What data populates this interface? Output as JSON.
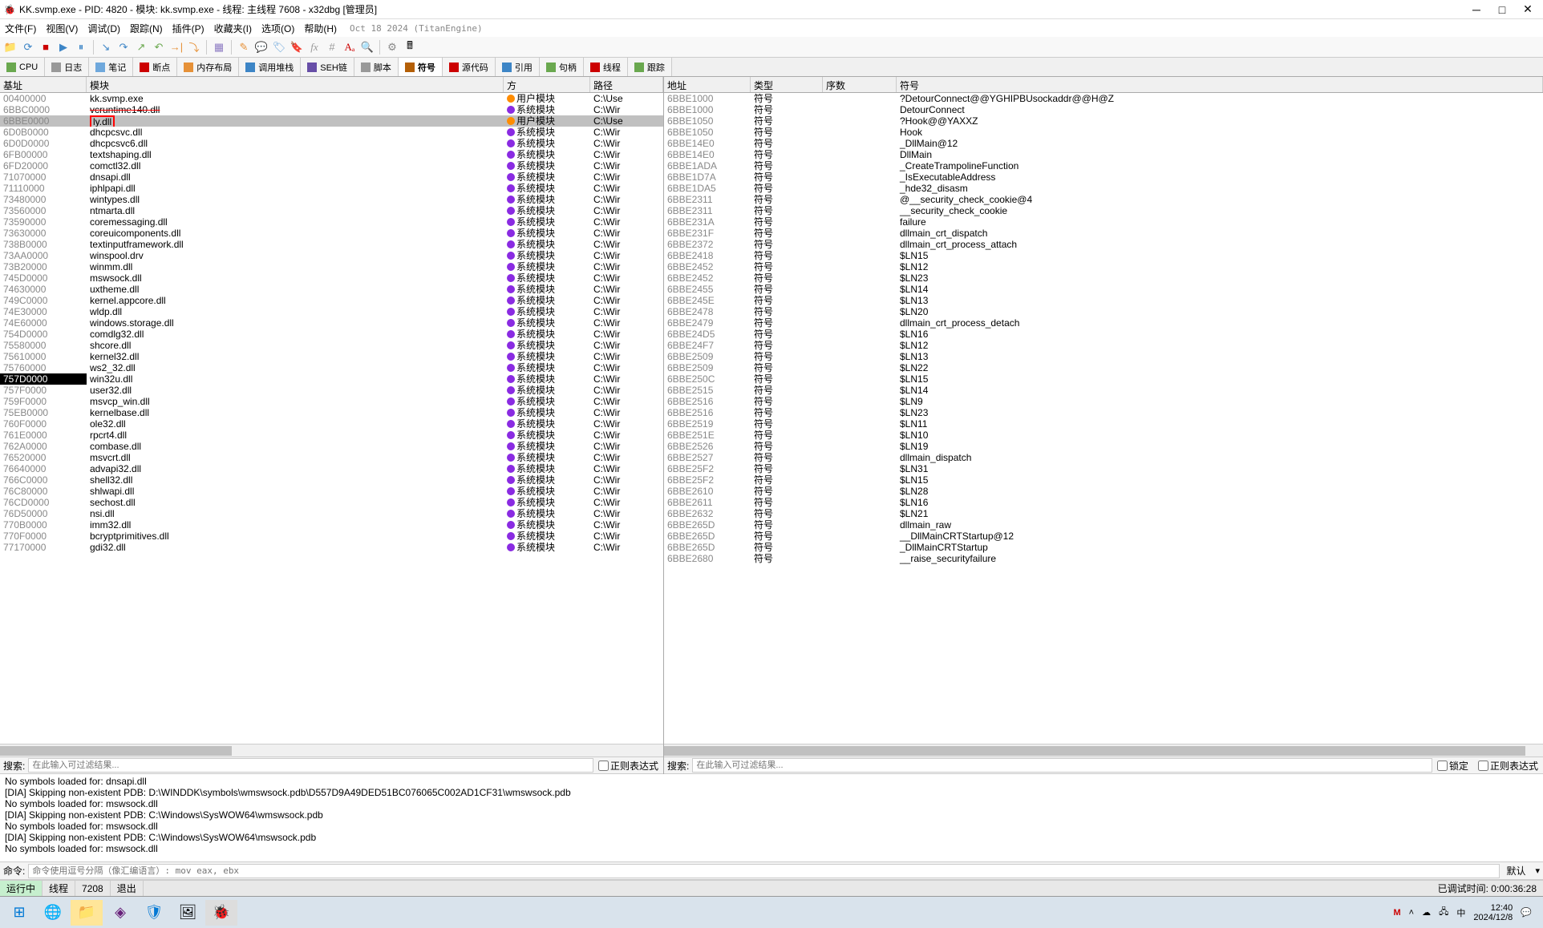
{
  "window": {
    "title": "KK.svmp.exe - PID: 4820 - 模块: kk.svmp.exe - 线程: 主线程 7608 - x32dbg [管理员]"
  },
  "menu": {
    "items": [
      "文件(F)",
      "视图(V)",
      "调试(D)",
      "跟踪(N)",
      "插件(P)",
      "收藏夹(I)",
      "选项(O)",
      "帮助(H)"
    ],
    "date": "Oct 18 2024 (TitanEngine)"
  },
  "tabs": [
    {
      "label": "CPU",
      "color": "#6aa84f"
    },
    {
      "label": "日志",
      "color": "#999"
    },
    {
      "label": "笔记",
      "color": "#6fa8dc"
    },
    {
      "label": "断点",
      "color": "#cc0000"
    },
    {
      "label": "内存布局",
      "color": "#e69138"
    },
    {
      "label": "调用堆栈",
      "color": "#3d85c6"
    },
    {
      "label": "SEH链",
      "color": "#674ea7"
    },
    {
      "label": "脚本",
      "color": "#999"
    },
    {
      "label": "符号",
      "color": "#b45f06",
      "active": true
    },
    {
      "label": "源代码",
      "color": "#cc0000"
    },
    {
      "label": "引用",
      "color": "#3d85c6"
    },
    {
      "label": "句柄",
      "color": "#6aa84f"
    },
    {
      "label": "线程",
      "color": "#cc0000"
    },
    {
      "label": "跟踪",
      "color": "#6aa84f"
    }
  ],
  "left_headers": {
    "base": "基址",
    "module": "模块",
    "side": "方",
    "path": "路径"
  },
  "right_headers": {
    "addr": "地址",
    "type": "类型",
    "ord": "序数",
    "sym": "符号"
  },
  "modules": [
    {
      "base": "00400000",
      "name": "kk.svmp.exe",
      "side": "用户模块",
      "user": true,
      "path": "C:\\Use"
    },
    {
      "base": "6BBC0000",
      "name": "vcruntime140.dll",
      "side": "系统模块",
      "user": false,
      "path": "C:\\Wir",
      "strike": true
    },
    {
      "base": "6BBE0000",
      "name": "ly.dll",
      "side": "用户模块",
      "user": true,
      "path": "C:\\Use",
      "selected": true,
      "redbox": true
    },
    {
      "base": "6D0B0000",
      "name": "dhcpcsvc.dll",
      "side": "系统模块",
      "user": false,
      "path": "C:\\Wir"
    },
    {
      "base": "6D0D0000",
      "name": "dhcpcsvc6.dll",
      "side": "系统模块",
      "user": false,
      "path": "C:\\Wir"
    },
    {
      "base": "6FB00000",
      "name": "textshaping.dll",
      "side": "系统模块",
      "user": false,
      "path": "C:\\Wir"
    },
    {
      "base": "6FD20000",
      "name": "comctl32.dll",
      "side": "系统模块",
      "user": false,
      "path": "C:\\Wir"
    },
    {
      "base": "71070000",
      "name": "dnsapi.dll",
      "side": "系统模块",
      "user": false,
      "path": "C:\\Wir"
    },
    {
      "base": "71110000",
      "name": "iphlpapi.dll",
      "side": "系统模块",
      "user": false,
      "path": "C:\\Wir"
    },
    {
      "base": "73480000",
      "name": "wintypes.dll",
      "side": "系统模块",
      "user": false,
      "path": "C:\\Wir"
    },
    {
      "base": "73560000",
      "name": "ntmarta.dll",
      "side": "系统模块",
      "user": false,
      "path": "C:\\Wir"
    },
    {
      "base": "73590000",
      "name": "coremessaging.dll",
      "side": "系统模块",
      "user": false,
      "path": "C:\\Wir"
    },
    {
      "base": "73630000",
      "name": "coreuicomponents.dll",
      "side": "系统模块",
      "user": false,
      "path": "C:\\Wir"
    },
    {
      "base": "738B0000",
      "name": "textinputframework.dll",
      "side": "系统模块",
      "user": false,
      "path": "C:\\Wir"
    },
    {
      "base": "73AA0000",
      "name": "winspool.drv",
      "side": "系统模块",
      "user": false,
      "path": "C:\\Wir"
    },
    {
      "base": "73B20000",
      "name": "winmm.dll",
      "side": "系统模块",
      "user": false,
      "path": "C:\\Wir"
    },
    {
      "base": "745D0000",
      "name": "mswsock.dll",
      "side": "系统模块",
      "user": false,
      "path": "C:\\Wir"
    },
    {
      "base": "74630000",
      "name": "uxtheme.dll",
      "side": "系统模块",
      "user": false,
      "path": "C:\\Wir"
    },
    {
      "base": "749C0000",
      "name": "kernel.appcore.dll",
      "side": "系统模块",
      "user": false,
      "path": "C:\\Wir"
    },
    {
      "base": "74E30000",
      "name": "wldp.dll",
      "side": "系统模块",
      "user": false,
      "path": "C:\\Wir"
    },
    {
      "base": "74E60000",
      "name": "windows.storage.dll",
      "side": "系统模块",
      "user": false,
      "path": "C:\\Wir"
    },
    {
      "base": "754D0000",
      "name": "comdlg32.dll",
      "side": "系统模块",
      "user": false,
      "path": "C:\\Wir"
    },
    {
      "base": "75580000",
      "name": "shcore.dll",
      "side": "系统模块",
      "user": false,
      "path": "C:\\Wir"
    },
    {
      "base": "75610000",
      "name": "kernel32.dll",
      "side": "系统模块",
      "user": false,
      "path": "C:\\Wir"
    },
    {
      "base": "75760000",
      "name": "ws2_32.dll",
      "side": "系统模块",
      "user": false,
      "path": "C:\\Wir"
    },
    {
      "base": "757D0000",
      "name": "win32u.dll",
      "side": "系统模块",
      "user": false,
      "path": "C:\\Wir",
      "highlight": true
    },
    {
      "base": "757F0000",
      "name": "user32.dll",
      "side": "系统模块",
      "user": false,
      "path": "C:\\Wir"
    },
    {
      "base": "759F0000",
      "name": "msvcp_win.dll",
      "side": "系统模块",
      "user": false,
      "path": "C:\\Wir"
    },
    {
      "base": "75EB0000",
      "name": "kernelbase.dll",
      "side": "系统模块",
      "user": false,
      "path": "C:\\Wir"
    },
    {
      "base": "760F0000",
      "name": "ole32.dll",
      "side": "系统模块",
      "user": false,
      "path": "C:\\Wir"
    },
    {
      "base": "761E0000",
      "name": "rpcrt4.dll",
      "side": "系统模块",
      "user": false,
      "path": "C:\\Wir"
    },
    {
      "base": "762A0000",
      "name": "combase.dll",
      "side": "系统模块",
      "user": false,
      "path": "C:\\Wir"
    },
    {
      "base": "76520000",
      "name": "msvcrt.dll",
      "side": "系统模块",
      "user": false,
      "path": "C:\\Wir"
    },
    {
      "base": "76640000",
      "name": "advapi32.dll",
      "side": "系统模块",
      "user": false,
      "path": "C:\\Wir"
    },
    {
      "base": "766C0000",
      "name": "shell32.dll",
      "side": "系统模块",
      "user": false,
      "path": "C:\\Wir"
    },
    {
      "base": "76C80000",
      "name": "shlwapi.dll",
      "side": "系统模块",
      "user": false,
      "path": "C:\\Wir"
    },
    {
      "base": "76CD0000",
      "name": "sechost.dll",
      "side": "系统模块",
      "user": false,
      "path": "C:\\Wir"
    },
    {
      "base": "76D50000",
      "name": "nsi.dll",
      "side": "系统模块",
      "user": false,
      "path": "C:\\Wir"
    },
    {
      "base": "770B0000",
      "name": "imm32.dll",
      "side": "系统模块",
      "user": false,
      "path": "C:\\Wir"
    },
    {
      "base": "770F0000",
      "name": "bcryptprimitives.dll",
      "side": "系统模块",
      "user": false,
      "path": "C:\\Wir"
    },
    {
      "base": "77170000",
      "name": "gdi32.dll",
      "side": "系统模块",
      "user": false,
      "path": "C:\\Wir"
    }
  ],
  "symbols": [
    {
      "addr": "6BBE1000",
      "type": "符号",
      "ord": "",
      "sym": "?DetourConnect@@YGHIPBUsockaddr@@H@Z"
    },
    {
      "addr": "6BBE1000",
      "type": "符号",
      "ord": "",
      "sym": "DetourConnect"
    },
    {
      "addr": "6BBE1050",
      "type": "符号",
      "ord": "",
      "sym": "?Hook@@YAXXZ"
    },
    {
      "addr": "6BBE1050",
      "type": "符号",
      "ord": "",
      "sym": "Hook"
    },
    {
      "addr": "6BBE14E0",
      "type": "符号",
      "ord": "",
      "sym": "_DllMain@12"
    },
    {
      "addr": "6BBE14E0",
      "type": "符号",
      "ord": "",
      "sym": "DllMain"
    },
    {
      "addr": "6BBE1ADA",
      "type": "符号",
      "ord": "",
      "sym": "_CreateTrampolineFunction"
    },
    {
      "addr": "6BBE1D7A",
      "type": "符号",
      "ord": "",
      "sym": "_IsExecutableAddress"
    },
    {
      "addr": "6BBE1DA5",
      "type": "符号",
      "ord": "",
      "sym": "_hde32_disasm"
    },
    {
      "addr": "6BBE2311",
      "type": "符号",
      "ord": "",
      "sym": "@__security_check_cookie@4"
    },
    {
      "addr": "6BBE2311",
      "type": "符号",
      "ord": "",
      "sym": "__security_check_cookie"
    },
    {
      "addr": "6BBE231A",
      "type": "符号",
      "ord": "",
      "sym": "failure"
    },
    {
      "addr": "6BBE231F",
      "type": "符号",
      "ord": "",
      "sym": "dllmain_crt_dispatch"
    },
    {
      "addr": "6BBE2372",
      "type": "符号",
      "ord": "",
      "sym": "dllmain_crt_process_attach"
    },
    {
      "addr": "6BBE2418",
      "type": "符号",
      "ord": "",
      "sym": "$LN15"
    },
    {
      "addr": "6BBE2452",
      "type": "符号",
      "ord": "",
      "sym": "$LN12"
    },
    {
      "addr": "6BBE2452",
      "type": "符号",
      "ord": "",
      "sym": "$LN23"
    },
    {
      "addr": "6BBE2455",
      "type": "符号",
      "ord": "",
      "sym": "$LN14"
    },
    {
      "addr": "6BBE245E",
      "type": "符号",
      "ord": "",
      "sym": "$LN13"
    },
    {
      "addr": "6BBE2478",
      "type": "符号",
      "ord": "",
      "sym": "$LN20"
    },
    {
      "addr": "6BBE2479",
      "type": "符号",
      "ord": "",
      "sym": "dllmain_crt_process_detach"
    },
    {
      "addr": "6BBE24D5",
      "type": "符号",
      "ord": "",
      "sym": "$LN16"
    },
    {
      "addr": "6BBE24F7",
      "type": "符号",
      "ord": "",
      "sym": "$LN12"
    },
    {
      "addr": "6BBE2509",
      "type": "符号",
      "ord": "",
      "sym": "$LN13"
    },
    {
      "addr": "6BBE2509",
      "type": "符号",
      "ord": "",
      "sym": "$LN22"
    },
    {
      "addr": "6BBE250C",
      "type": "符号",
      "ord": "",
      "sym": "$LN15"
    },
    {
      "addr": "6BBE2515",
      "type": "符号",
      "ord": "",
      "sym": "$LN14"
    },
    {
      "addr": "6BBE2516",
      "type": "符号",
      "ord": "",
      "sym": "$LN9"
    },
    {
      "addr": "6BBE2516",
      "type": "符号",
      "ord": "",
      "sym": "$LN23"
    },
    {
      "addr": "6BBE2519",
      "type": "符号",
      "ord": "",
      "sym": "$LN11"
    },
    {
      "addr": "6BBE251E",
      "type": "符号",
      "ord": "",
      "sym": "$LN10"
    },
    {
      "addr": "6BBE2526",
      "type": "符号",
      "ord": "",
      "sym": "$LN19"
    },
    {
      "addr": "6BBE2527",
      "type": "符号",
      "ord": "",
      "sym": "dllmain_dispatch"
    },
    {
      "addr": "6BBE25F2",
      "type": "符号",
      "ord": "",
      "sym": "$LN31"
    },
    {
      "addr": "6BBE25F2",
      "type": "符号",
      "ord": "",
      "sym": "$LN15"
    },
    {
      "addr": "6BBE2610",
      "type": "符号",
      "ord": "",
      "sym": "$LN28"
    },
    {
      "addr": "6BBE2611",
      "type": "符号",
      "ord": "",
      "sym": "$LN16"
    },
    {
      "addr": "6BBE2632",
      "type": "符号",
      "ord": "",
      "sym": "$LN21"
    },
    {
      "addr": "6BBE265D",
      "type": "符号",
      "ord": "",
      "sym": "dllmain_raw"
    },
    {
      "addr": "6BBE265D",
      "type": "符号",
      "ord": "",
      "sym": "__DllMainCRTStartup@12"
    },
    {
      "addr": "6BBE265D",
      "type": "符号",
      "ord": "",
      "sym": "_DllMainCRTStartup"
    },
    {
      "addr": "6BBE2680",
      "type": "符号",
      "ord": "",
      "sym": "__raise_securityfailure"
    }
  ],
  "search": {
    "label": "搜索:",
    "placeholder": "在此输入可过滤结果...",
    "regex": "正则表达式",
    "lock": "锁定"
  },
  "log": [
    "No symbols loaded for: dnsapi.dll",
    "[DIA] Skipping non-existent PDB: D:\\WINDDK\\symbols\\wmswsock.pdb\\D557D9A49DED51BC076065C002AD1CF31\\wmswsock.pdb",
    "No symbols loaded for: mswsock.dll",
    "[DIA] Skipping non-existent PDB: C:\\Windows\\SysWOW64\\wmswsock.pdb",
    "No symbols loaded for: mswsock.dll",
    "[DIA] Skipping non-existent PDB: C:\\Windows\\SysWOW64\\mswsock.pdb",
    "No symbols loaded for: mswsock.dll"
  ],
  "cmd": {
    "label": "命令:",
    "placeholder": "命令使用逗号分隔（像汇编语言）: mov eax, ebx",
    "default": "默认"
  },
  "status": {
    "state": "运行中",
    "thread": "线程",
    "tid": "7208",
    "exit": "退出",
    "debugtime_lbl": "已调试时间:",
    "debugtime": "0:00:36:28"
  },
  "clock": {
    "time": "12:40",
    "date": "2024/12/8"
  }
}
